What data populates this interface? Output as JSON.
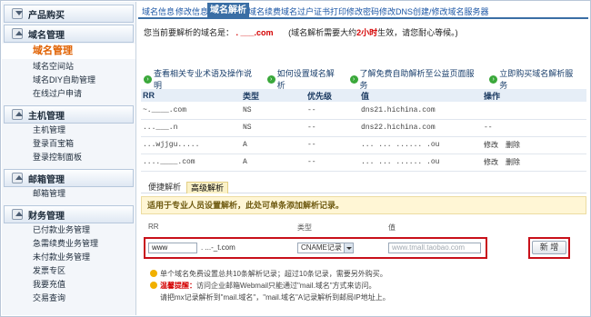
{
  "sidebar": {
    "sections": [
      {
        "label": "产品购买",
        "icon": "arrow-down-icon",
        "items": []
      },
      {
        "label": "域名管理",
        "icon": "arrow-up-icon",
        "items": [
          {
            "label": "域名管理",
            "active": true
          },
          {
            "label": "域名空间站"
          },
          {
            "label": "域名DIY自助管理"
          },
          {
            "label": "在线过户申请"
          }
        ]
      },
      {
        "label": "主机管理",
        "icon": "arrow-up-icon",
        "items": [
          {
            "label": "主机管理"
          },
          {
            "label": "登录百宝箱"
          },
          {
            "label": "登录控制面板"
          }
        ]
      },
      {
        "label": "邮箱管理",
        "icon": "arrow-up-icon",
        "items": [
          {
            "label": "邮箱管理"
          }
        ]
      },
      {
        "label": "财务管理",
        "icon": "arrow-up-icon",
        "items": [
          {
            "label": "已付款业务管理"
          },
          {
            "label": "急需续费业务管理"
          },
          {
            "label": "未付款业务管理"
          },
          {
            "label": "发票专区"
          },
          {
            "label": "我要充值"
          },
          {
            "label": "交易查询"
          }
        ]
      }
    ]
  },
  "tabs": [
    {
      "label": "域名信息"
    },
    {
      "label": "修改信息"
    },
    {
      "label": "域名解析",
      "active": true
    },
    {
      "label": "域名续费"
    },
    {
      "label": "域名过户"
    },
    {
      "label": "证书打印"
    },
    {
      "label": "修改密码"
    },
    {
      "label": "修改DNS"
    },
    {
      "label": "创建/修改域名服务器"
    }
  ],
  "current": {
    "prefix": "您当前要解析的域名是：",
    "domain": ". ___.com",
    "note_a": "(域名解析需要大约",
    "note_hours": "2小时",
    "note_b": "生效，请您耐心等候。)"
  },
  "help_links": [
    {
      "label": "查看相关专业术语及操作说明"
    },
    {
      "label": "如何设置域名解析"
    },
    {
      "label": "了解免费自助解析至公益页面服务"
    },
    {
      "label": "立即购买域名解析服务"
    }
  ],
  "records_table": {
    "headers": [
      "RR",
      "类型",
      "优先级",
      "值",
      "操作"
    ],
    "rows": [
      {
        "rr": "~.____.com",
        "type": "NS",
        "priority": "--",
        "value": "dns21.hichina.com",
        "ops": []
      },
      {
        "rr": "...___.n",
        "type": "NS",
        "priority": "--",
        "value": "dns22.hichina.com",
        "ops": [
          "--"
        ]
      },
      {
        "rr": "...wjjgu.....",
        "type": "A",
        "priority": "--",
        "value": "... ... ...... .ou",
        "ops": [
          "修改",
          "删除"
        ]
      },
      {
        "rr": "....____.com",
        "type": "A",
        "priority": "--",
        "value": "... ... ...... .ou",
        "ops": [
          "修改",
          "删除"
        ]
      }
    ]
  },
  "subtabs": [
    {
      "label": "便捷解析"
    },
    {
      "label": "高级解析",
      "active": true
    }
  ],
  "notice": "适用于专业人员设置解析，此处可单条添加解析记录。",
  "form": {
    "col_rr": "RR",
    "col_type": "类型",
    "col_value": "值",
    "rr_value": "www",
    "domain_suffix": ". ...-_t.com",
    "type_value": "CNAME记录",
    "value_placeholder": "www.tmall.taobao.com",
    "add_label": "新 增"
  },
  "tips": {
    "line1": "单个域名免费设置总共10条解析记录；超过10条记录，需要另外购买。",
    "warn_label": "温馨提醒：",
    "line2": "访问企业邮箱Webmail只能通过\"mail.域名\"方式来访问。",
    "line3": "请把mx记录解析到\"mail.域名\"，\"mail.域名\"A记录解析到邮局IP地址上。"
  }
}
